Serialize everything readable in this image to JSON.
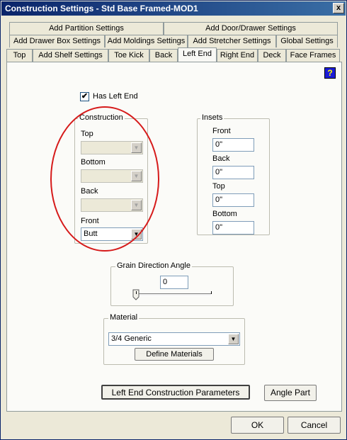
{
  "window": {
    "title": "Construction Settings - Std Base Framed-MOD1",
    "close_glyph": "x"
  },
  "tabs": {
    "row1": [
      "Add Partition Settings",
      "Add Door/Drawer Settings"
    ],
    "row2": [
      "Add Drawer Box Settings",
      "Add Moldings Settings",
      "Add Stretcher Settings",
      "Global Settings"
    ],
    "row3": [
      "Top",
      "Add Shelf Settings",
      "Toe Kick",
      "Back",
      "Left End",
      "Right End",
      "Deck",
      "Face Frames"
    ],
    "active": "Left End"
  },
  "help": {
    "glyph": "?"
  },
  "has_left_end": {
    "label": "Has Left End",
    "checked": true,
    "check_glyph": "✔"
  },
  "construction": {
    "title": "Construction",
    "top_label": "Top",
    "top_value": "",
    "bottom_label": "Bottom",
    "bottom_value": "",
    "back_label": "Back",
    "back_value": "",
    "front_label": "Front",
    "front_value": "Butt"
  },
  "insets": {
    "title": "Insets",
    "front_label": "Front",
    "front_value": "0\"",
    "back_label": "Back",
    "back_value": "0\"",
    "top_label": "Top",
    "top_value": "0\"",
    "bottom_label": "Bottom",
    "bottom_value": "0\""
  },
  "grain": {
    "title": "Grain Direction Angle",
    "value": "0"
  },
  "material": {
    "title": "Material",
    "selected": "3/4 Generic",
    "define_label": "Define Materials"
  },
  "buttons": {
    "params_label": "Left End Construction Parameters",
    "angle_label": "Angle Part",
    "ok_label": "OK",
    "cancel_label": "Cancel"
  },
  "arrow_glyph": "▼",
  "annotation_color": "#d61a1a"
}
